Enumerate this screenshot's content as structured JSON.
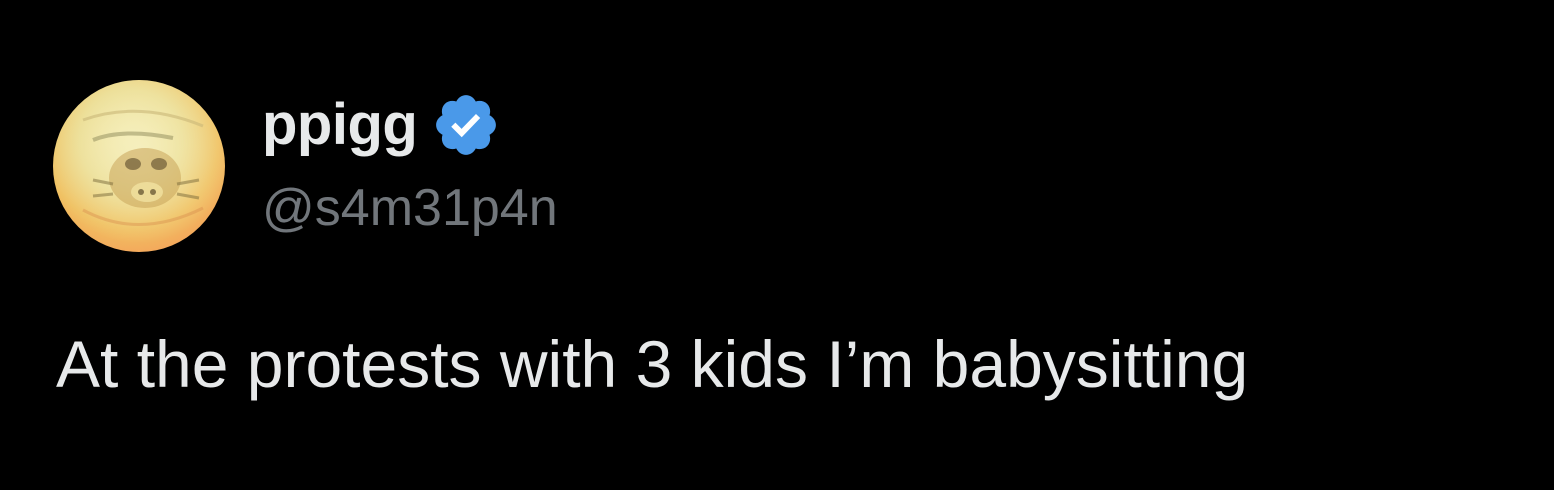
{
  "tweet": {
    "author": {
      "display_name": "ppigg",
      "handle": "@s4m31p4n",
      "verified": true,
      "verified_color": "#4a99e9",
      "avatar_icon": "avatar-image"
    },
    "text": "At the protests with 3 kids I’m babysitting"
  },
  "colors": {
    "background": "#000000",
    "primary_text": "#e7e9ea",
    "secondary_text": "#71767b"
  }
}
